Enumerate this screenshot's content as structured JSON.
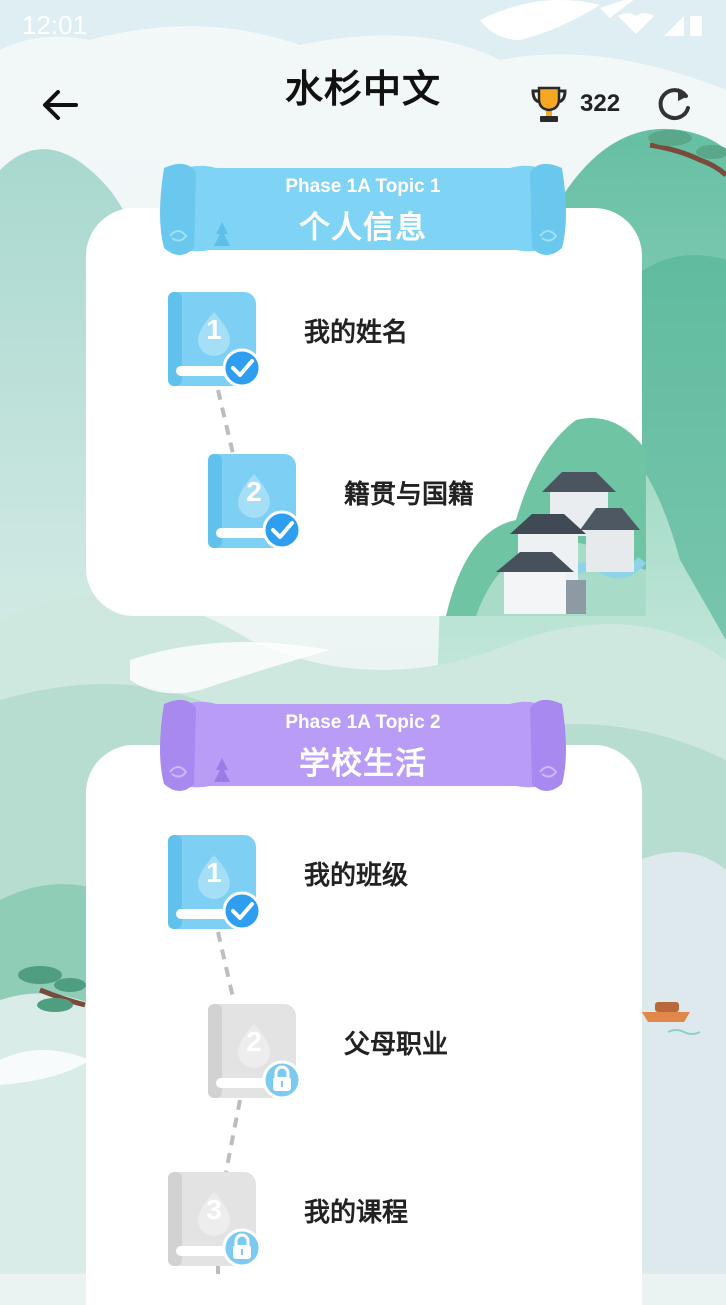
{
  "status_bar": {
    "time": "12:01"
  },
  "header": {
    "title": "水杉中文",
    "score": "322"
  },
  "colors": {
    "topic1": "#7fd3f5",
    "topic2": "#b89cf6",
    "book_done": "#7dd0f3",
    "book_locked": "#e3e3e3",
    "check_badge": "#2d9ef0"
  },
  "topics": [
    {
      "subtitle": "Phase 1A Topic 1",
      "title": "个人信息",
      "lessons": [
        {
          "number": "1",
          "name": "我的姓名",
          "status": "completed"
        },
        {
          "number": "2",
          "name": "籍贯与国籍",
          "status": "completed"
        }
      ]
    },
    {
      "subtitle": "Phase 1A Topic 2",
      "title": "学校生活",
      "lessons": [
        {
          "number": "1",
          "name": "我的班级",
          "status": "completed"
        },
        {
          "number": "2",
          "name": "父母职业",
          "status": "locked"
        },
        {
          "number": "3",
          "name": "我的课程",
          "status": "locked"
        }
      ]
    }
  ]
}
